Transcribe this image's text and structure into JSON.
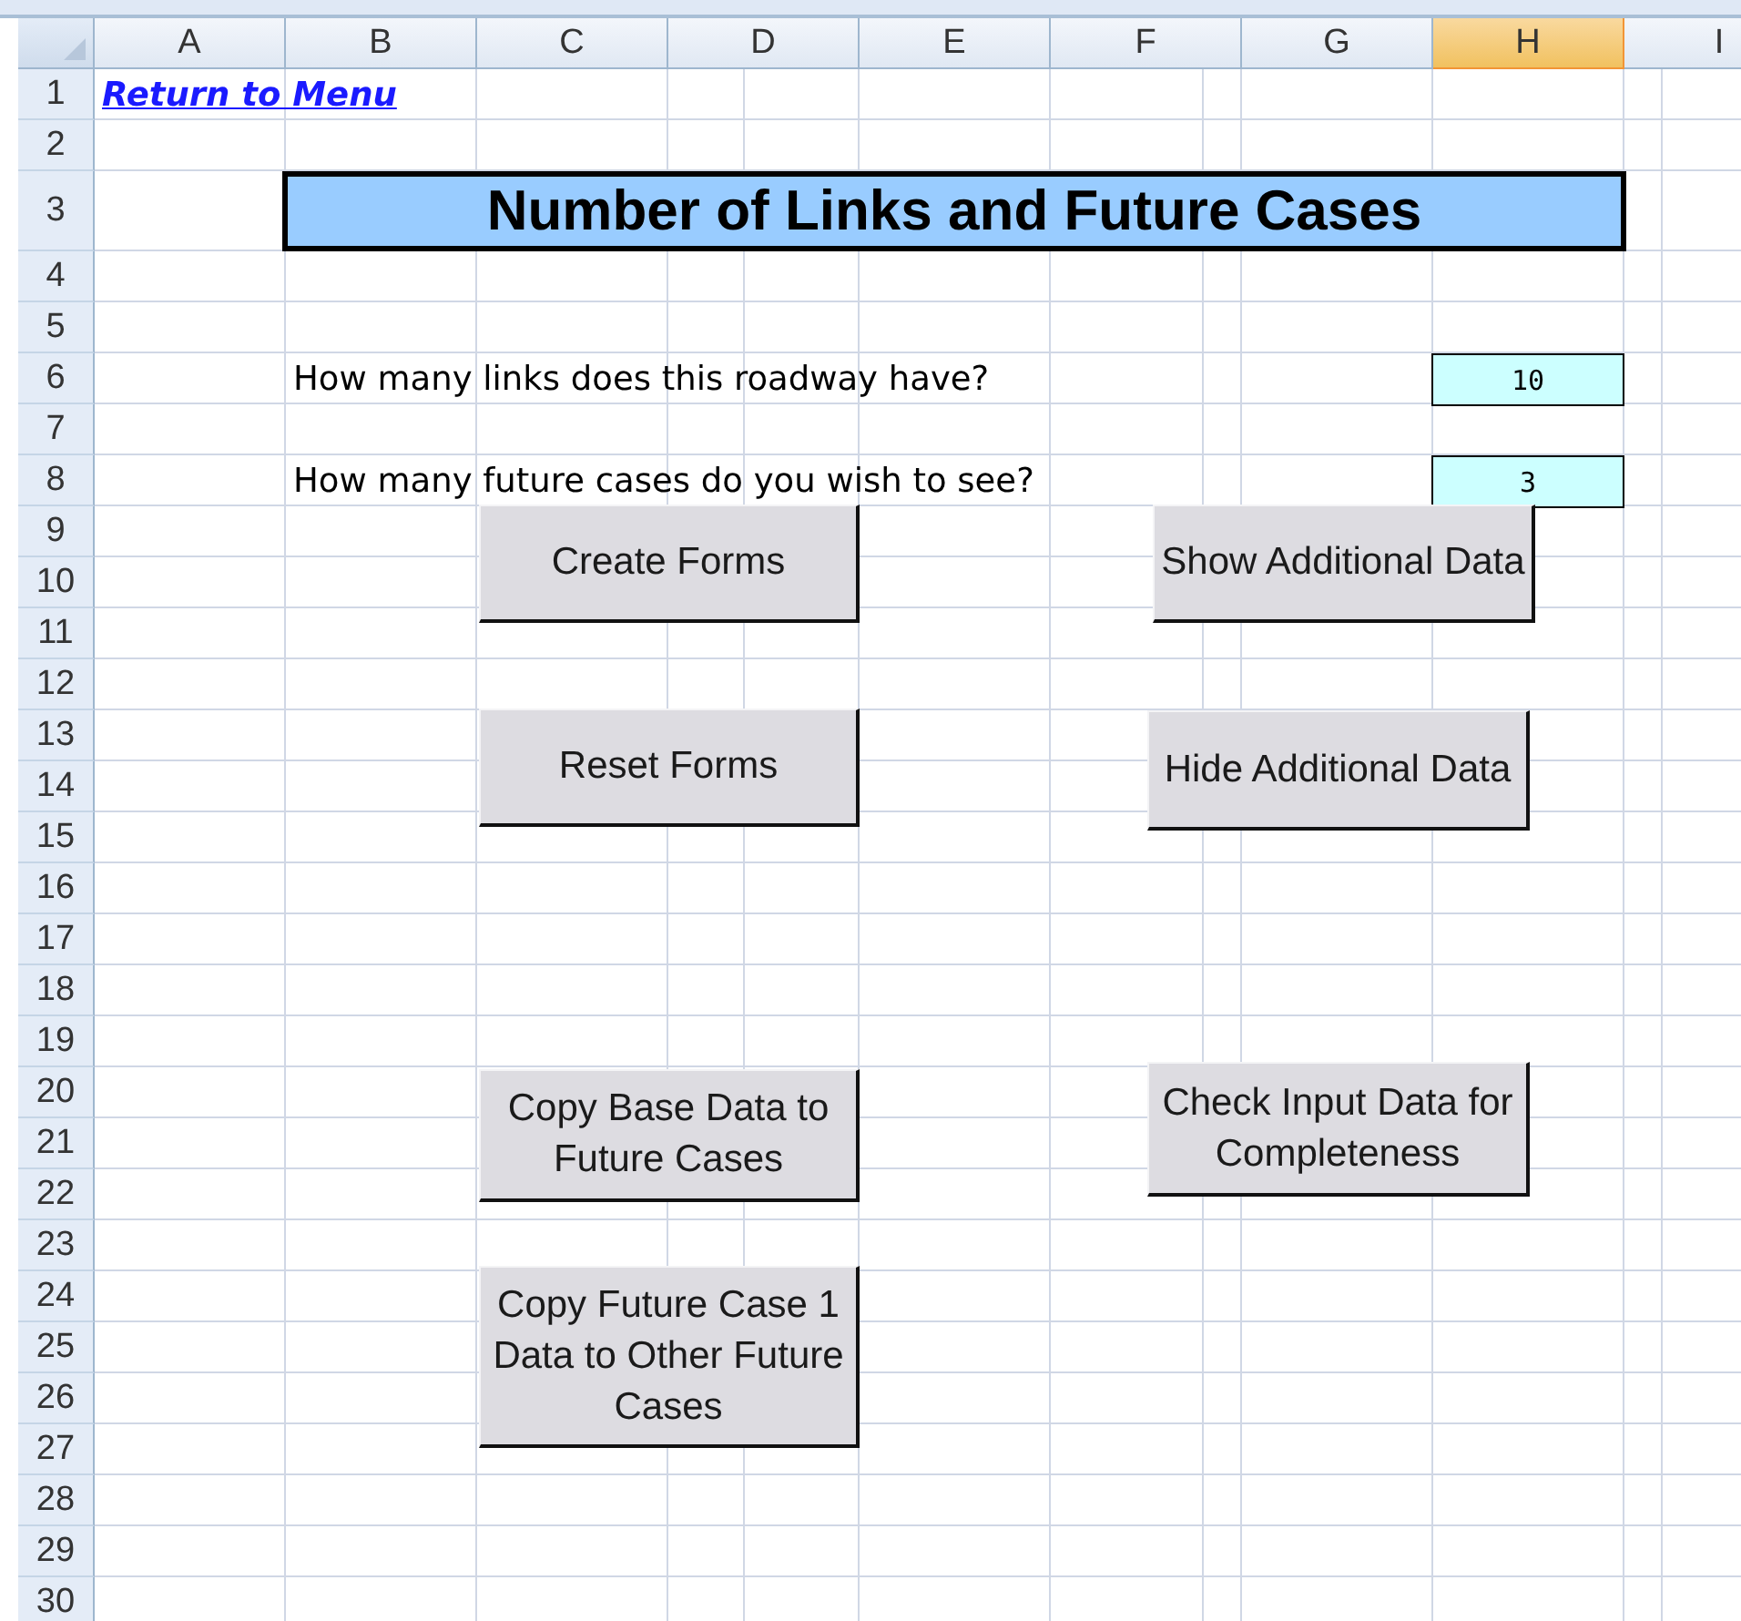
{
  "columns": [
    {
      "label": "A",
      "selected": false
    },
    {
      "label": "B",
      "selected": false
    },
    {
      "label": "C",
      "selected": false
    },
    {
      "label": "D",
      "selected": false
    },
    {
      "label": "E",
      "selected": false
    },
    {
      "label": "F",
      "selected": false
    },
    {
      "label": "G",
      "selected": false
    },
    {
      "label": "H",
      "selected": true
    },
    {
      "label": "I",
      "selected": false
    }
  ],
  "rows": [
    "1",
    "2",
    "3",
    "4",
    "5",
    "6",
    "7",
    "8",
    "9",
    "10",
    "11",
    "12",
    "13",
    "14",
    "15",
    "16",
    "17",
    "18",
    "19",
    "20",
    "21",
    "22",
    "23",
    "24",
    "25",
    "26",
    "27",
    "28",
    "29",
    "30"
  ],
  "link": "Return to Menu",
  "title": "Number of Links and Future Cases",
  "questions": [
    {
      "label": "How many links does this roadway have?",
      "value": "10"
    },
    {
      "label": "How many future cases do you wish to see?",
      "value": "3"
    }
  ],
  "buttons": [
    {
      "label": "Create Forms"
    },
    {
      "label": "Show Additional Data"
    },
    {
      "label": "Reset Forms"
    },
    {
      "label": "Hide Additional Data"
    },
    {
      "label": "Copy Base Data to Future Cases"
    },
    {
      "label": "Check Input Data for Completeness"
    },
    {
      "label": "Copy Future Case 1 Data to Other Future Cases"
    }
  ]
}
